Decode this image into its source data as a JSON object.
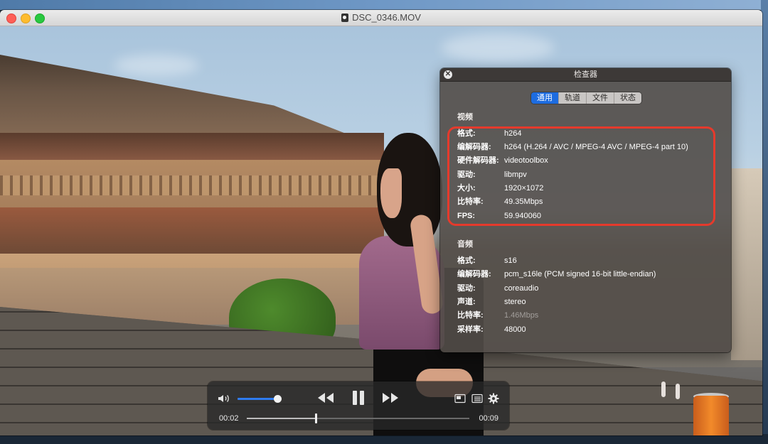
{
  "window": {
    "title": "DSC_0346.MOV"
  },
  "inspector": {
    "title": "检查器",
    "close_glyph": "✕",
    "tabs": [
      {
        "label": "通用",
        "active": true
      },
      {
        "label": "轨道",
        "active": false
      },
      {
        "label": "文件",
        "active": false
      },
      {
        "label": "状态",
        "active": false
      }
    ],
    "video": {
      "heading": "视频",
      "rows": [
        {
          "key": "格式:",
          "value": "h264"
        },
        {
          "key": "编解码器:",
          "value": "h264 (H.264 / AVC / MPEG-4 AVC / MPEG-4 part 10)"
        },
        {
          "key": "硬件解码器:",
          "value": "videotoolbox"
        },
        {
          "key": "驱动:",
          "value": "libmpv"
        },
        {
          "key": "大小:",
          "value": "1920×1072"
        },
        {
          "key": "比特率:",
          "value": "49.35Mbps"
        },
        {
          "key": "FPS:",
          "value": "59.940060"
        }
      ]
    },
    "audio": {
      "heading": "音频",
      "rows": [
        {
          "key": "格式:",
          "value": "s16"
        },
        {
          "key": "编解码器:",
          "value": "pcm_s16le (PCM signed 16-bit little-endian)"
        },
        {
          "key": "驱动:",
          "value": "coreaudio"
        },
        {
          "key": "声道:",
          "value": "stereo"
        },
        {
          "key": "比特率:",
          "value": "1.46Mbps"
        },
        {
          "key": "采样率:",
          "value": "48000"
        }
      ]
    },
    "highlight_color": "#e53a2c"
  },
  "player": {
    "current_time": "00:02",
    "total_time": "00:09",
    "volume_level": 0.9,
    "seek_progress": 0.31,
    "accent_color": "#2f7cf0",
    "icons": [
      "volume-icon",
      "rewind-icon",
      "pause-icon",
      "fast-forward-icon",
      "picture-in-picture-icon",
      "playlist-icon",
      "settings-icon"
    ]
  }
}
